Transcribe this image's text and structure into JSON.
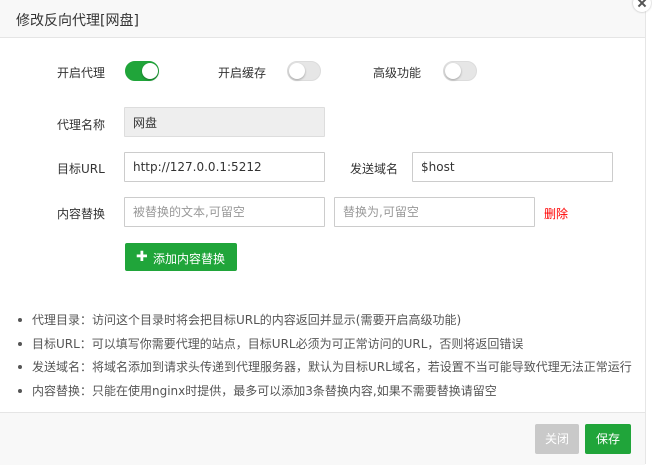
{
  "dialog": {
    "title": "修改反向代理[网盘]"
  },
  "toggles": {
    "proxy": {
      "label": "开启代理",
      "on": true
    },
    "cache": {
      "label": "开启缓存",
      "on": false
    },
    "advanced": {
      "label": "高级功能",
      "on": false
    }
  },
  "form": {
    "name_label": "代理名称",
    "name_value": "网盘",
    "target_label": "目标URL",
    "target_value": "http://127.0.0.1:5212",
    "send_domain_label": "发送域名",
    "send_domain_value": "$host",
    "replace_label": "内容替换",
    "replace_from_placeholder": "被替换的文本,可留空",
    "replace_to_placeholder": "替换为,可留空",
    "delete_label": "删除",
    "add_replace_label": "添加内容替换"
  },
  "tips": [
    "代理目录：访问这个目录时将会把目标URL的内容返回并显示(需要开启高级功能)",
    "目标URL：可以填写你需要代理的站点，目标URL必须为可正常访问的URL，否则将返回错误",
    "发送域名：将域名添加到请求头传递到代理服务器，默认为目标URL域名，若设置不当可能导致代理无法正常运行",
    "内容替换：只能在使用nginx时提供，最多可以添加3条替换内容,如果不需要替换请留空"
  ],
  "footer": {
    "close_label": "关闭",
    "save_label": "保存"
  },
  "colors": {
    "accent": "#20a53a",
    "danger": "#ff0000",
    "disabled": "#c9c9c9"
  }
}
